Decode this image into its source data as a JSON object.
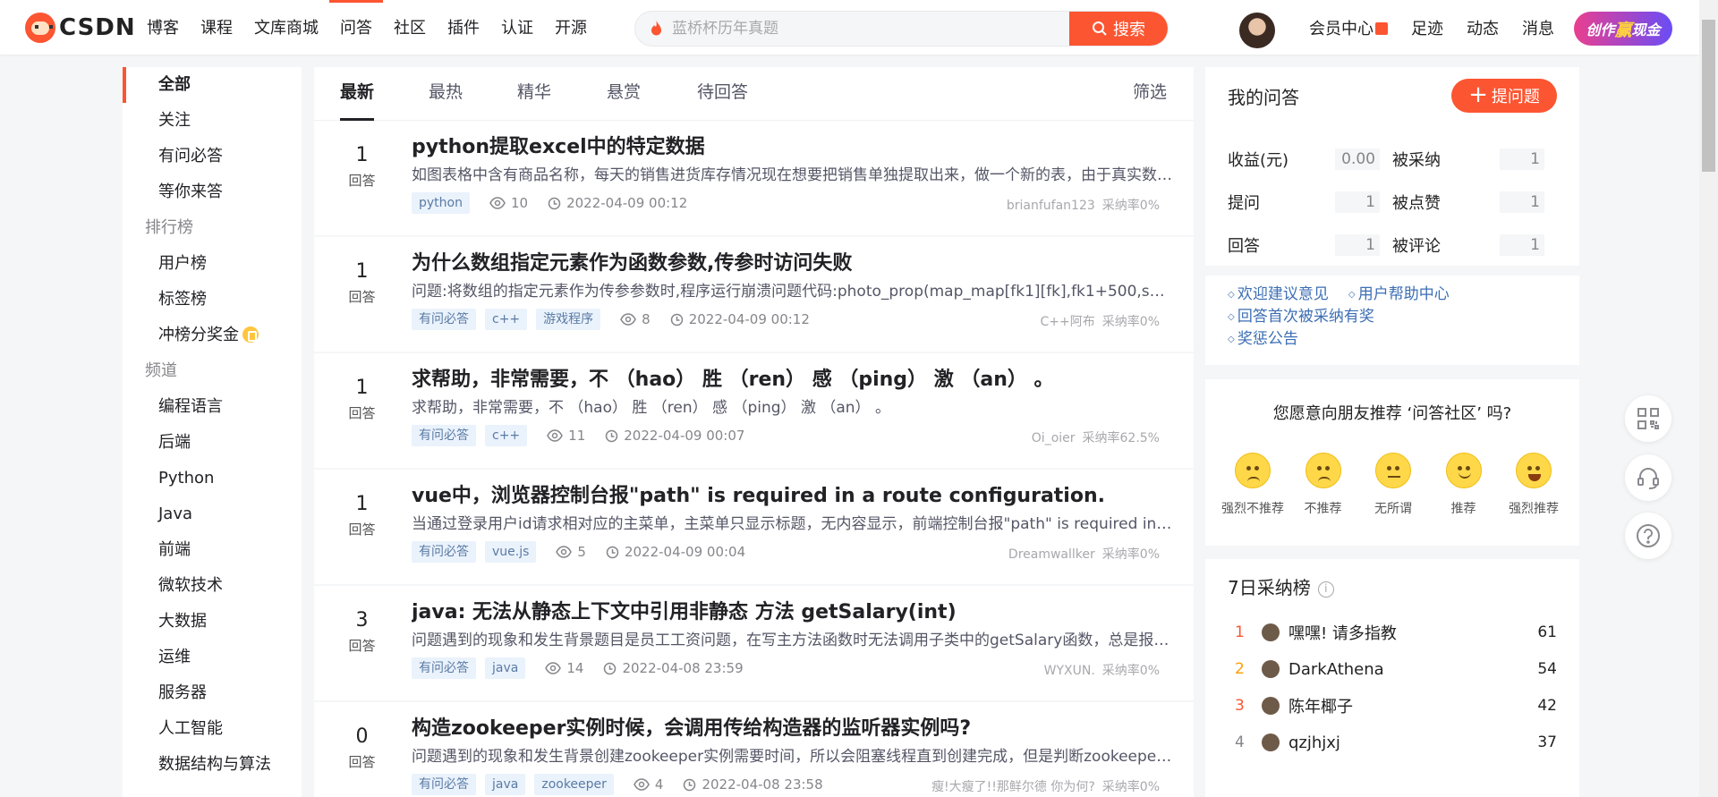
{
  "brand": {
    "logo_text": "CSDN"
  },
  "nav": [
    "博客",
    "课程",
    "文库商城",
    "问答",
    "社区",
    "插件",
    "认证",
    "开源"
  ],
  "nav_active_index": 3,
  "search": {
    "placeholder": "蓝桥杯历年真题",
    "button_label": "搜索"
  },
  "top_right": {
    "links": [
      "会员中心",
      "足迹",
      "动态",
      "消息"
    ],
    "create_pre": "创作",
    "create_mid": "赢",
    "create_post": "现金"
  },
  "sidebar": {
    "group1": [
      "全部",
      "关注",
      "有问必答",
      "等你来答"
    ],
    "rank_head": "排行榜",
    "rank_items": [
      "用户榜",
      "标签榜",
      "冲榜分奖金"
    ],
    "channel_head": "频道",
    "channel_items": [
      "编程语言",
      "后端",
      "Python",
      "Java",
      "前端",
      "微软技术",
      "大数据",
      "运维",
      "服务器",
      "人工智能",
      "数据结构与算法"
    ]
  },
  "tabs": [
    "最新",
    "最热",
    "精华",
    "悬赏",
    "待回答"
  ],
  "filter_label": "筛选",
  "answer_label": "回答",
  "questions": [
    {
      "count": "1",
      "title": "python提取excel中的特定数据",
      "desc": "如图表格中含有商品名称，每天的销售进货库存情况现在想要把销售单独提取出来，做一个新的表，由于真实数据太多，想问问用python怎么处理",
      "tags": [
        "python"
      ],
      "views": "10",
      "time": "2022-04-09 00:12",
      "user": "brianfufan123",
      "rate": "采纳率0%"
    },
    {
      "count": "1",
      "title": "为什么数组指定元素作为函数参数,传参时访问失败",
      "desc": "问题:将数组的指定元素作为传参参数时,程序运行崩溃问题代码:photo_prop(map_map[fk1][fk],fk1+500,ss2);photo_prop函数",
      "tags": [
        "有问必答",
        "c++",
        "游戏程序"
      ],
      "views": "8",
      "time": "2022-04-09 00:12",
      "user": "C++阿布",
      "rate": "采纳率0%"
    },
    {
      "count": "1",
      "title": "求帮助，非常需要，不 （hao） 胜 （ren） 感 （ping） 激 （an） 。",
      "desc": " 求帮助，非常需要，不 （hao） 胜 （ren） 感 （ping） 激 （an） 。",
      "tags": [
        "有问必答",
        "c++"
      ],
      "views": "11",
      "time": "2022-04-09 00:07",
      "user": "Oi_oier",
      "rate": "采纳率62.5%"
    },
    {
      "count": "1",
      "title": "vue中，浏览器控制台报\"path\" is required in a route configuration.",
      "desc": "当通过登录用户id请求相对应的主菜单，主菜单只显示标题，无内容显示，前端控制台报\"path\" is required in a route configuration.",
      "tags": [
        "有问必答",
        "vue.js"
      ],
      "views": "5",
      "time": "2022-04-09 00:04",
      "user": "Dreamwallker",
      "rate": "采纳率0%"
    },
    {
      "count": "3",
      "title": "java: 无法从静态上下文中引用非静态 方法 getSalary(int)",
      "desc": "问题遇到的现象和发生背景题目是员工工资问题，在写主方法函数时无法调用子类中的getSalary函数，总是报错无法从静态上下文中引用",
      "tags": [
        "有问必答",
        "java"
      ],
      "views": "14",
      "time": "2022-04-08 23:59",
      "user": "WYXUN.",
      "rate": "采纳率0%"
    },
    {
      "count": "0",
      "title": "构造zookeeper实例时候，会调用传给构造器的监听器实例吗?",
      "desc": "问题遇到的现象和发生背景创建zookeeper实例需要时间，所以会阻塞线程直到创建完成，但是判断zookeeper实例是否创建完成",
      "tags": [
        "有问必答",
        "java",
        "zookeeper"
      ],
      "views": "4",
      "time": "2022-04-08 23:58",
      "user": "瘦!大瘦了!!那鲜尔德 你为何?",
      "rate": "采纳率0%"
    }
  ],
  "my_qa": {
    "title": "我的问答",
    "ask_label": "提问题",
    "stats": [
      {
        "label": "收益(元)",
        "value": "0.00"
      },
      {
        "label": "被采纳",
        "value": "1"
      },
      {
        "label": "提问",
        "value": "1"
      },
      {
        "label": "被点赞",
        "value": "1"
      },
      {
        "label": "回答",
        "value": "1"
      },
      {
        "label": "被评论",
        "value": "1"
      }
    ]
  },
  "help_links": [
    "欢迎建议意见",
    "用户帮助中心",
    "回答首次被采纳有奖",
    "奖惩公告"
  ],
  "recommend": {
    "question": "您愿意向朋友推荐 ‘问答社区’ 吗?",
    "options": [
      "强烈不推荐",
      "不推荐",
      "无所谓",
      "推荐",
      "强烈推荐"
    ]
  },
  "leaderboard": {
    "title": "7日采纳榜",
    "rows": [
      {
        "rank": "1",
        "name": "嘿嘿! 请多指教",
        "score": "61",
        "color": "#fc5531"
      },
      {
        "rank": "2",
        "name": "DarkAthena",
        "score": "54",
        "color": "#ff9d00"
      },
      {
        "rank": "3",
        "name": "陈年椰子",
        "score": "42",
        "color": "#fc5531"
      },
      {
        "rank": "4",
        "name": "qzjhjxj",
        "score": "37",
        "color": "#86868b"
      }
    ]
  },
  "colors": {
    "accent": "#fc5531",
    "link": "#3c6eb4",
    "tag_bg": "#eaf2fc"
  }
}
